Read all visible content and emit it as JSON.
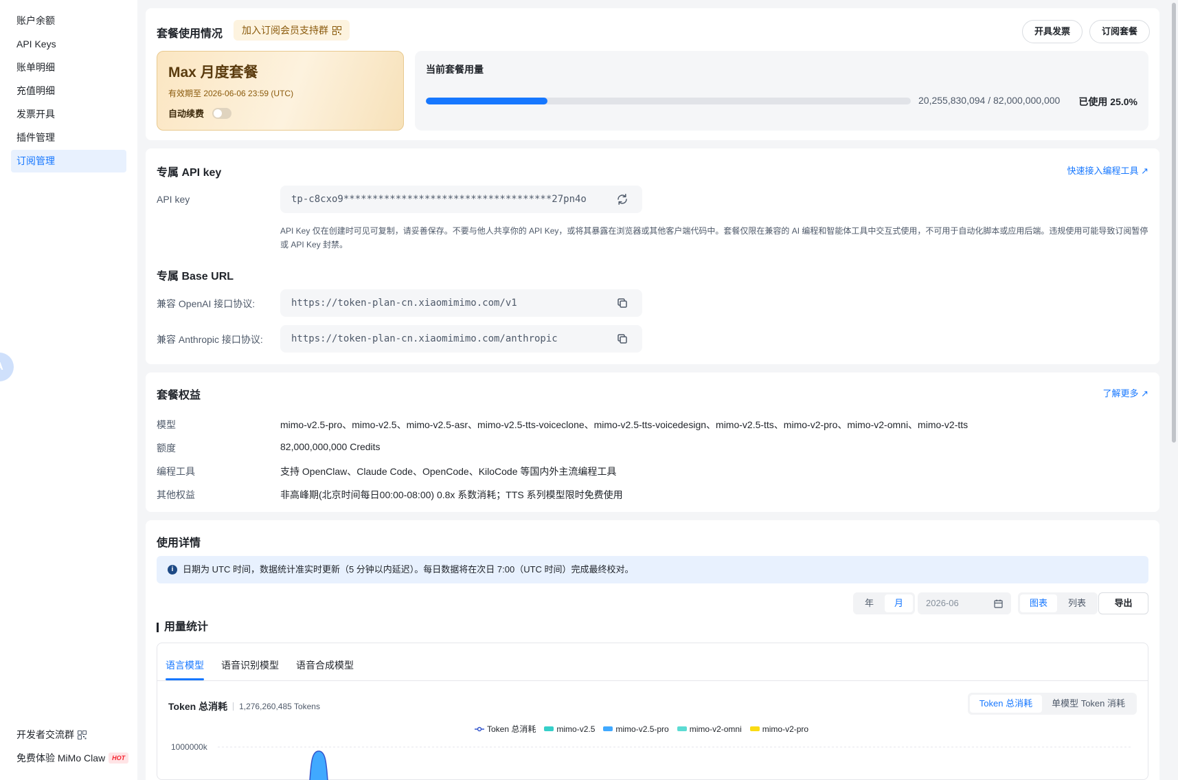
{
  "sidebar": {
    "items": [
      {
        "label": "账户余额",
        "active": false
      },
      {
        "label": "API Keys",
        "active": false
      },
      {
        "label": "账单明细",
        "active": false
      },
      {
        "label": "充值明细",
        "active": false
      },
      {
        "label": "发票开具",
        "active": false
      },
      {
        "label": "插件管理",
        "active": false
      },
      {
        "label": "订阅管理",
        "active": true
      }
    ],
    "bottom": {
      "community_label": "开发者交流群",
      "claw_label": "免费体验 MiMo Claw",
      "hot_badge": "HOT"
    },
    "float_button_text": "A"
  },
  "subscription": {
    "title": "套餐使用情况",
    "member_tag": "加入订阅会员支持群",
    "invoice_button": "开具发票",
    "subscribe_button": "订阅套餐",
    "plan": {
      "name": "Max 月度套餐",
      "expire": "有效期至 2026-06-06 23:59 (UTC)",
      "auto_renew_label": "自动续费",
      "auto_renew_on": false
    },
    "usage": {
      "title": "当前套餐用量",
      "numbers": "20,255,830,094 / 82,000,000,000",
      "percent_label": "已使用 25.0%",
      "fraction": 0.25
    }
  },
  "api": {
    "title": "专属 API key",
    "quick_link": "快速接入编程工具 ↗",
    "key_label": "API key",
    "key_value": "tp-c8cxo9************************************27pn4o",
    "warning": "API Key 仅在创建时可见可复制，请妥善保存。不要与他人共享你的 API Key，或将其暴露在浏览器或其他客户端代码中。套餐仅限在兼容的 AI 编程和智能体工具中交互式使用，不可用于自动化脚本或应用后端。违规使用可能导致订阅暂停或 API Key 封禁。",
    "base_url_title": "专属 Base URL",
    "openai_label": "兼容 OpenAI 接口协议:",
    "openai_url": "https://token-plan-cn.xiaomimimo.com/v1",
    "anthropic_label": "兼容 Anthropic 接口协议:",
    "anthropic_url": "https://token-plan-cn.xiaomimimo.com/anthropic"
  },
  "benefits": {
    "title": "套餐权益",
    "more_link": "了解更多 ↗",
    "rows": [
      {
        "label": "模型",
        "value": "mimo-v2.5-pro、mimo-v2.5、mimo-v2.5-asr、mimo-v2.5-tts-voiceclone、mimo-v2.5-tts-voicedesign、mimo-v2.5-tts、mimo-v2-pro、mimo-v2-omni、mimo-v2-tts"
      },
      {
        "label": "额度",
        "value": "82,000,000,000 Credits"
      },
      {
        "label": "编程工具",
        "value": "支持 OpenClaw、Claude Code、OpenCode、KiloCode 等国内外主流编程工具"
      },
      {
        "label": "其他权益",
        "value": "非高峰期(北京时间每日00:00-08:00) 0.8x 系数消耗；TTS 系列模型限时免费使用"
      }
    ]
  },
  "usage_detail": {
    "title": "使用详情",
    "info": "日期为 UTC 时间，数据统计准实时更新（5 分钟以内延迟）。每日数据将在次日 7:00（UTC 时间）完成最终校对。",
    "period": {
      "year": "年",
      "month": "月",
      "selected": "月"
    },
    "date_value": "2026-06",
    "view": {
      "chart": "图表",
      "list": "列表",
      "selected": "图表"
    },
    "export_button": "导出",
    "stats_title": "用量统计",
    "tabs": [
      {
        "label": "语言模型",
        "active": true
      },
      {
        "label": "语音识别模型",
        "active": false
      },
      {
        "label": "语音合成模型",
        "active": false
      }
    ],
    "token_total_label": "Token 总消耗",
    "token_total_value": "1,276,260,485 Tokens",
    "metric": {
      "total": "Token 总消耗",
      "single": "单模型 Token 消耗",
      "selected": "Token 总消耗"
    }
  },
  "chart_data": {
    "type": "area",
    "legend": [
      {
        "name": "Token 总消耗",
        "color": "#3355cc"
      },
      {
        "name": "mimo-v2.5",
        "color": "#36cfc9"
      },
      {
        "name": "mimo-v2.5-pro",
        "color": "#40a9ff"
      },
      {
        "name": "mimo-v2-omni",
        "color": "#5cdbd3"
      },
      {
        "name": "mimo-v2-pro",
        "color": "#fadb14"
      }
    ],
    "y_ticks": [
      "1000000k"
    ],
    "grid": true,
    "legend_position": "top-center"
  },
  "colors": {
    "accent": "#1677ff",
    "plan_gold": "#8a5a0c"
  }
}
